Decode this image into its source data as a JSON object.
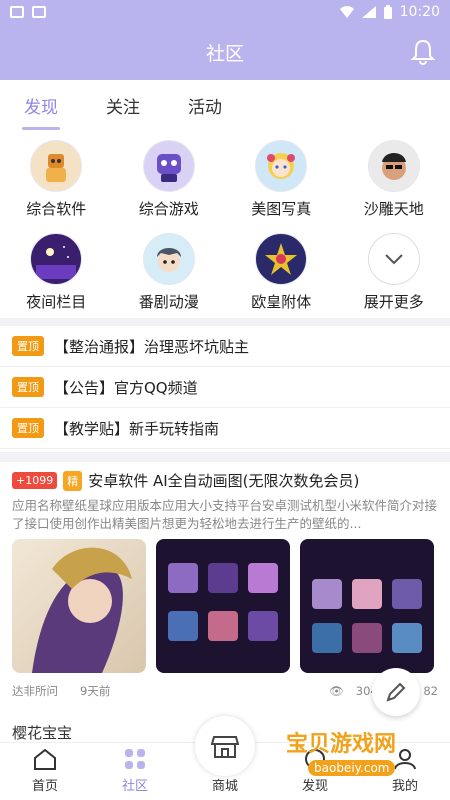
{
  "status": {
    "time": "10:20"
  },
  "header": {
    "title": "社区"
  },
  "tabs": [
    {
      "label": "发现"
    },
    {
      "label": "关注"
    },
    {
      "label": "活动"
    }
  ],
  "categories": [
    {
      "label": "综合软件",
      "icon": "robot-avatar-icon"
    },
    {
      "label": "综合游戏",
      "icon": "game-mascot-avatar-icon"
    },
    {
      "label": "美图写真",
      "icon": "girl-avatar-icon"
    },
    {
      "label": "沙雕天地",
      "icon": "meme-face-avatar-icon"
    },
    {
      "label": "夜间栏目",
      "icon": "night-moon-avatar-icon"
    },
    {
      "label": "番剧动漫",
      "icon": "anime-character-avatar-icon"
    },
    {
      "label": "欧皇附体",
      "icon": "lucky-star-avatar-icon"
    },
    {
      "label": "展开更多",
      "icon": "chevron-down-icon"
    }
  ],
  "pinned": [
    {
      "badge": "置顶",
      "title": "【整治通报】治理恶坏坑贴主"
    },
    {
      "badge": "置顶",
      "title": "【公告】官方QQ频道"
    },
    {
      "badge": "置顶",
      "title": "【教学贴】新手玩转指南"
    }
  ],
  "post": {
    "points": "+1099",
    "featured": "精",
    "title": "安卓软件 AI全自动画图(无限次数免会员)",
    "desc": "应用名称壁纸星球应用版本应用大小支持平台安卓测试机型小米软件简介对接了接口使用创作出精美图片想更为轻松地去进行生产的壁纸的...",
    "author": "达非所问",
    "time": "9天前",
    "views": "3047",
    "comments": "82"
  },
  "peek": {
    "title": "樱花宝宝"
  },
  "nav": [
    {
      "label": "首页",
      "icon": "home-icon"
    },
    {
      "label": "社区",
      "icon": "community-icon"
    },
    {
      "label": "商城",
      "icon": "store-icon"
    },
    {
      "label": "发现",
      "icon": "discover-icon"
    },
    {
      "label": "我的",
      "icon": "profile-icon"
    }
  ],
  "watermark": {
    "text": "宝贝游戏网",
    "url": "baobeiy.com"
  },
  "colors": {
    "accent": "#b9b4ee",
    "active": "#8f86e6",
    "pin": "#f39a15",
    "hot": "#ef4a3e"
  }
}
